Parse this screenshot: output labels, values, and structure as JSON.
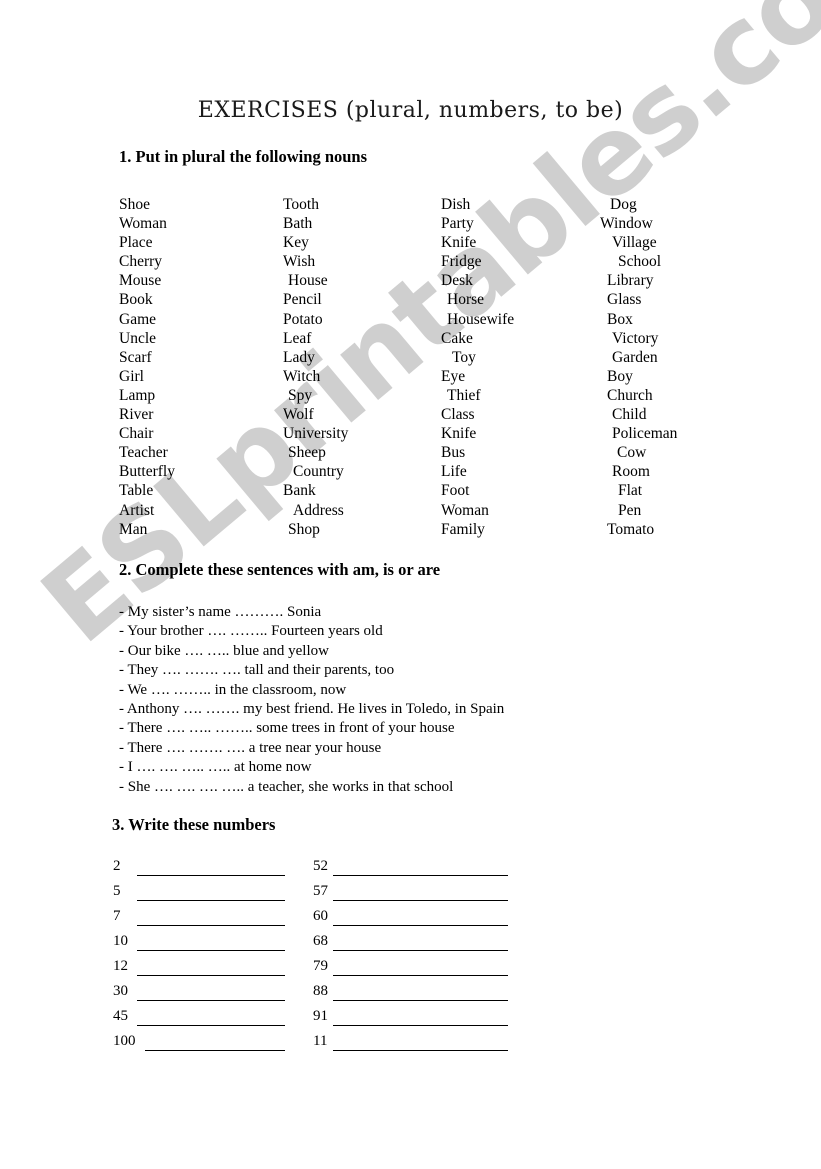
{
  "document": {
    "title": "EXERCISES (plural, numbers, to be)",
    "watermark": "ESLprintables.com",
    "watermark_color": "#cfcfcf"
  },
  "sections": {
    "nouns": {
      "heading": "1. Put in plural the following nouns",
      "columns": [
        [
          "Shoe",
          "Woman",
          "Place",
          "Cherry",
          "Mouse",
          "Book",
          "Game",
          "Uncle",
          "Scarf",
          "Girl",
          "Lamp",
          "River",
          "Chair",
          "Teacher",
          "Butterfly",
          "Table",
          "Artist",
          "Man"
        ],
        [
          "Tooth",
          "Bath",
          "Key",
          "Wish",
          "House",
          "Pencil",
          "Potato",
          "Leaf",
          "Lady",
          "Witch",
          "Spy",
          "Wolf",
          "University",
          "Sheep",
          "Country",
          "Bank",
          "Address",
          "Shop"
        ],
        [
          "Dish",
          "Party",
          "Knife",
          "Fridge",
          "Desk",
          "Horse",
          "Housewife",
          "Cake",
          "Toy",
          "Eye",
          "Thief",
          "Class",
          "Knife",
          "Bus",
          "Life",
          "Foot",
          "Woman",
          "Family"
        ],
        [
          "Dog",
          "Window",
          "Village",
          "School",
          "Library",
          "Glass",
          "Box",
          "Victory",
          "Garden",
          "Boy",
          "Church",
          "Child",
          "Policeman",
          "Cow",
          "Room",
          "Flat",
          "Pen",
          "Tomato"
        ]
      ]
    },
    "sentences": {
      "heading": "2. Complete these sentences with am, is or are",
      "items": [
        "- My sister’s name ………. Sonia",
        "- Your brother …. …….. Fourteen years old",
        "- Our bike …. ….. blue and yellow",
        "- They …. ……. …. tall and their parents, too",
        "- We …. …….. in the classroom, now",
        "- Anthony …. ……. my best friend. He lives in Toledo, in Spain",
        "- There …. ….. …….. some trees in front of your house",
        "- There …. ……. ….  a tree near your house",
        "- I …. …. ….. ….. at home now",
        "- She  …. …. …. ….. a teacher, she works in that school"
      ]
    },
    "numbers": {
      "heading": "3. Write these numbers",
      "columns": [
        [
          "2",
          "5",
          "7",
          "10",
          "12",
          "30",
          "45",
          "100"
        ],
        [
          "52",
          "57",
          "60",
          "68",
          "79",
          "88",
          "91",
          "11"
        ]
      ]
    }
  }
}
